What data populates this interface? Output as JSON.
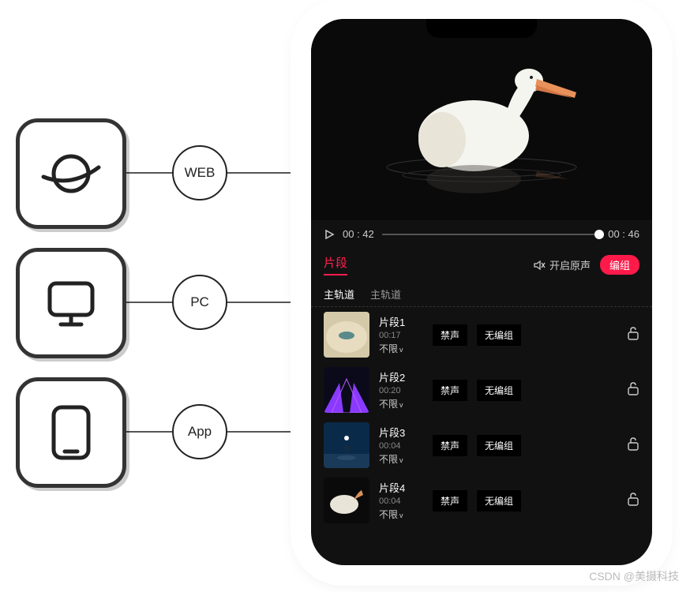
{
  "platforms": [
    {
      "label": "WEB"
    },
    {
      "label": "PC"
    },
    {
      "label": "App"
    }
  ],
  "player": {
    "current": "00 : 42",
    "total": "00 : 46"
  },
  "section": {
    "title": "片段",
    "open_audio": "开启原声",
    "group_btn": "编组"
  },
  "tracks": {
    "tab1": "主轨道",
    "tab2": "主轨道"
  },
  "clips": [
    {
      "name": "片段1",
      "duration": "00:17",
      "limit": "不限",
      "mute": "禁声",
      "group": "无编组"
    },
    {
      "name": "片段2",
      "duration": "00:20",
      "limit": "不限",
      "mute": "禁声",
      "group": "无编组"
    },
    {
      "name": "片段3",
      "duration": "00:04",
      "limit": "不限",
      "mute": "禁声",
      "group": "无编组"
    },
    {
      "name": "片段4",
      "duration": "00:04",
      "limit": "不限",
      "mute": "禁声",
      "group": "无编组"
    }
  ],
  "watermark": "CSDN @美摄科技"
}
